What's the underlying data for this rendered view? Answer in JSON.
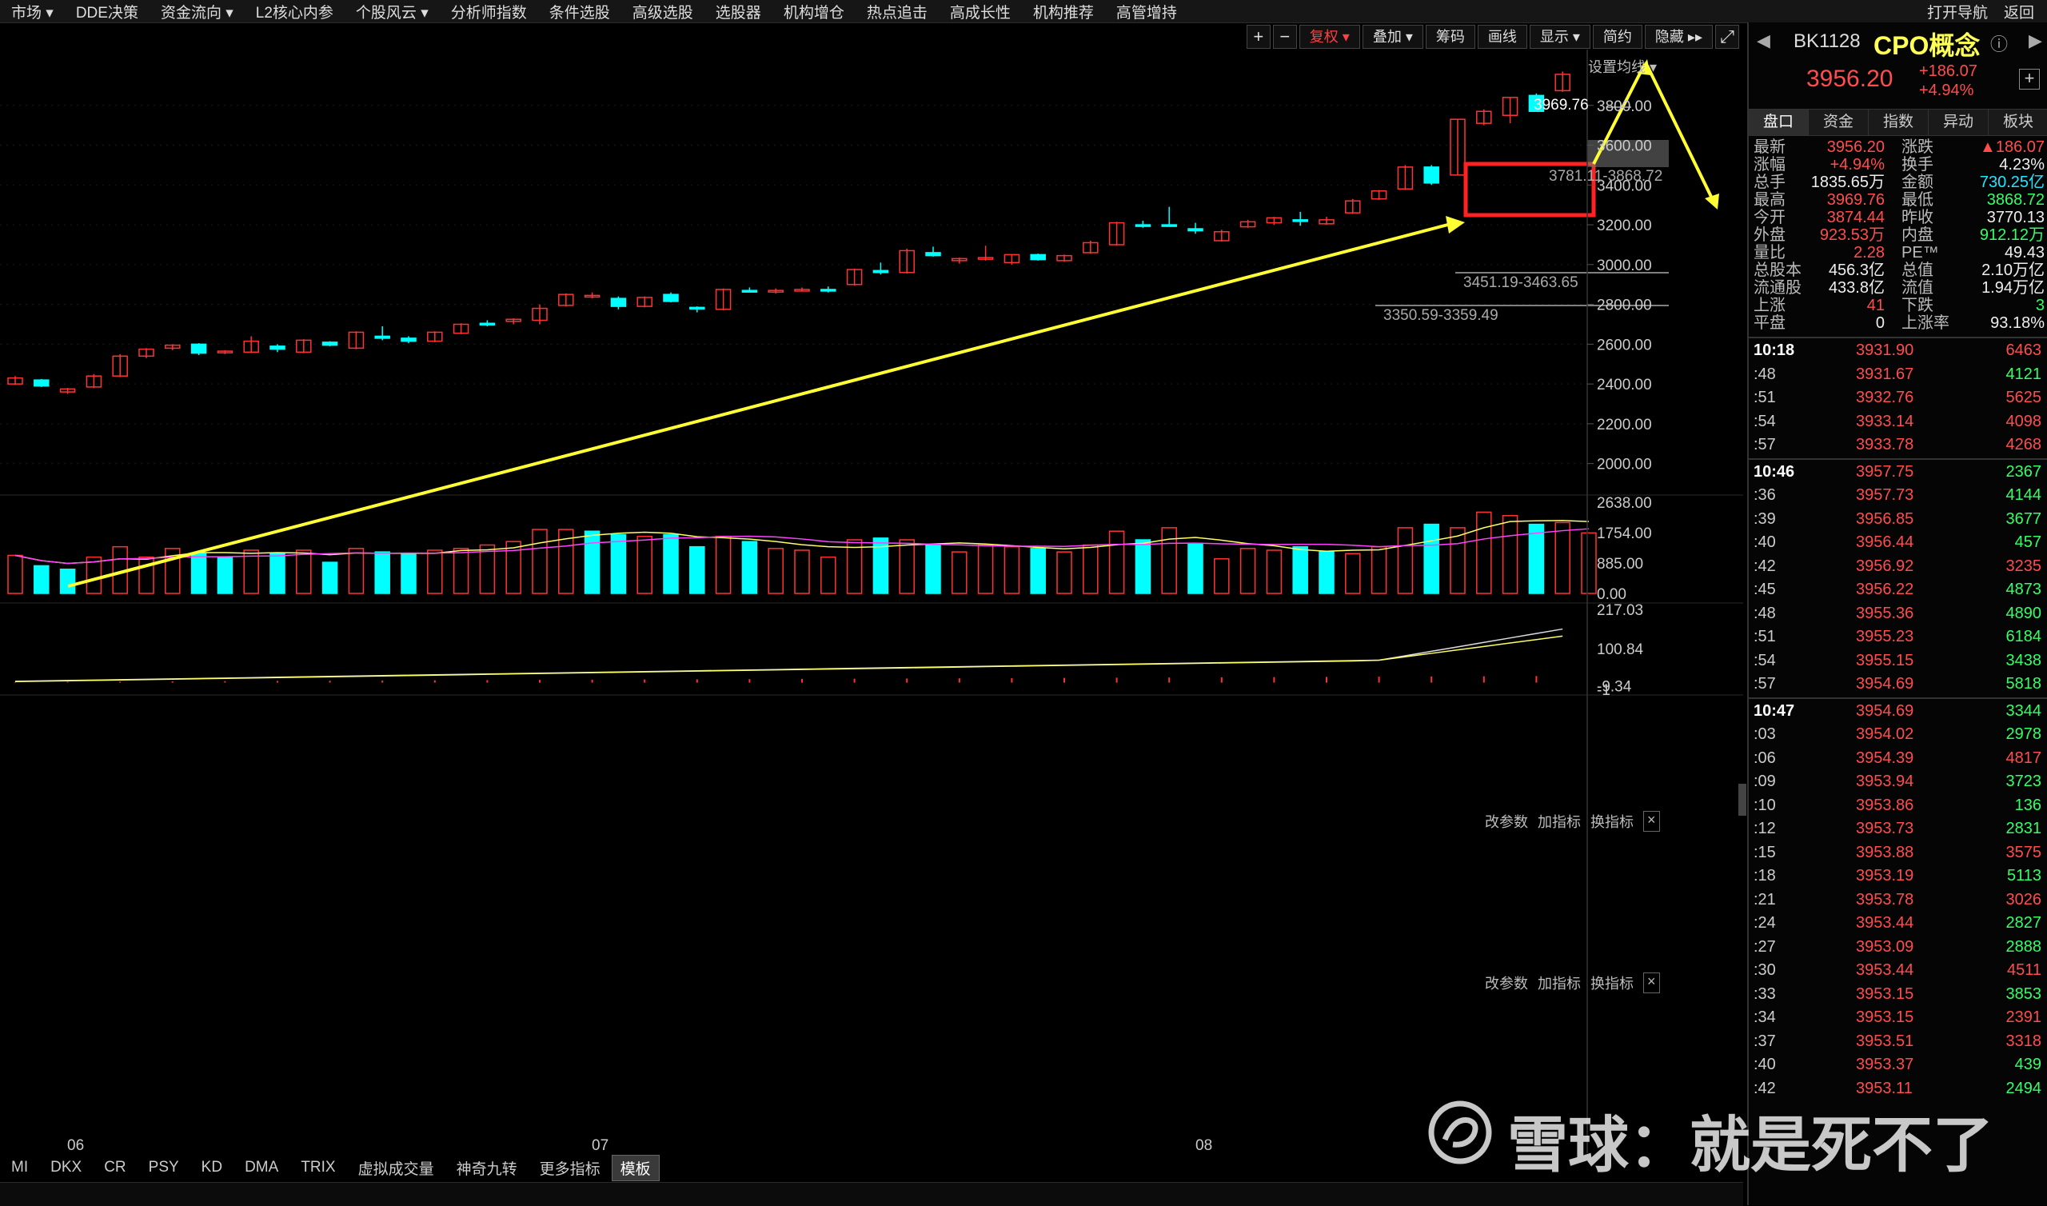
{
  "topmenu": {
    "items": [
      "市场 ▾",
      "DDE决策",
      "资金流向 ▾",
      "L2核心内参",
      "个股风云 ▾",
      "分析师指数",
      "条件选股",
      "高级选股",
      "选股器",
      "机构增仓",
      "热点追击",
      "高成长性",
      "机构推荐",
      "高管增持"
    ],
    "right": [
      "打开导航",
      "返回"
    ]
  },
  "toolbar": {
    "plus": "+",
    "minus": "−",
    "fuquan": "复权 ▾",
    "diejia": "叠加 ▾",
    "chouma": "筹码",
    "huaxian": "画线",
    "xianshi": "显示 ▾",
    "jianyue": "简约",
    "yincang": "隐藏 ▸▸",
    "fullscreen": "⤢"
  },
  "chart": {
    "set_ma_label": "设置均线 ▾",
    "high_label": "3969.76",
    "box_label_1": "3781.11-3868.72",
    "box_label_2": "3451.19-3463.65",
    "box_label_3": "3350.59-3359.49",
    "price_ticks": [
      "3800.00",
      "3600.00",
      "3400.00",
      "3200.00",
      "3000.00",
      "2800.00",
      "2600.00",
      "2400.00",
      "2200.00",
      "2000.00"
    ],
    "vol_ticks": [
      "2638.00",
      "1754.00",
      "885.00",
      "0.00"
    ],
    "macd_ticks": [
      "217.03",
      "100.84",
      "-9.34",
      "-1"
    ],
    "x_labels": [
      "06",
      "07",
      "08"
    ],
    "sub_links": [
      "改参数",
      "加指标",
      "换指标"
    ],
    "close_x": "×",
    "colors": {
      "up": "#ff3333",
      "down": "#00ffff",
      "arrow": "#ffff33",
      "box": "#ff2222",
      "ma1": "#ffff66",
      "ma2": "#ff44ff"
    }
  },
  "bottomtabs": [
    "MI",
    "DKX",
    "CR",
    "PSY",
    "KD",
    "DMA",
    "TRIX",
    "虚拟成交量",
    "神奇九转",
    "更多指标",
    "模板"
  ],
  "panel": {
    "code": "BK1128",
    "name": "CPO概念",
    "info_icon": "ⓘ",
    "price": "3956.20",
    "change": "+186.07",
    "change_pct": "+4.94%",
    "add": "+",
    "tabs": [
      "盘口",
      "资金",
      "指数",
      "异动",
      "板块"
    ],
    "quote": [
      [
        "最新",
        "3956.20",
        "涨跌",
        "▲186.07"
      ],
      [
        "涨幅",
        "+4.94%",
        "换手",
        "4.23%"
      ],
      [
        "总手",
        "1835.65万",
        "金额",
        "730.25亿"
      ],
      [
        "最高",
        "3969.76",
        "最低",
        "3868.72"
      ],
      [
        "今开",
        "3874.44",
        "昨收",
        "3770.13"
      ],
      [
        "外盘",
        "923.53万",
        "内盘",
        "912.12万"
      ],
      [
        "量比",
        "2.28",
        "PE™",
        "49.43"
      ],
      [
        "总股本",
        "456.3亿",
        "总值",
        "2.10万亿"
      ],
      [
        "流通股",
        "433.8亿",
        "流值",
        "1.94万亿"
      ],
      [
        "上涨",
        "41",
        "下跌",
        "3"
      ],
      [
        "平盘",
        "0",
        "上涨率",
        "93.18%"
      ]
    ],
    "ticks": [
      [
        "10:18",
        "3931.90",
        "6463",
        "r"
      ],
      [
        ":48",
        "3931.67",
        "4121",
        "g"
      ],
      [
        ":51",
        "3932.76",
        "5625",
        "r"
      ],
      [
        ":54",
        "3933.14",
        "4098",
        "r"
      ],
      [
        ":57",
        "3933.78",
        "4268",
        "r"
      ],
      [
        "10:46",
        "3957.75",
        "2367",
        "g"
      ],
      [
        ":36",
        "3957.73",
        "4144",
        "g"
      ],
      [
        ":39",
        "3956.85",
        "3677",
        "g"
      ],
      [
        ":40",
        "3956.44",
        "457",
        "g"
      ],
      [
        ":42",
        "3956.92",
        "3235",
        "r"
      ],
      [
        ":45",
        "3956.22",
        "4873",
        "g"
      ],
      [
        ":48",
        "3955.36",
        "4890",
        "g"
      ],
      [
        ":51",
        "3955.23",
        "6184",
        "g"
      ],
      [
        ":54",
        "3955.15",
        "3438",
        "g"
      ],
      [
        ":57",
        "3954.69",
        "5818",
        "g"
      ],
      [
        "10:47",
        "3954.69",
        "3344",
        "g"
      ],
      [
        ":03",
        "3954.02",
        "2978",
        "g"
      ],
      [
        ":06",
        "3954.39",
        "4817",
        "r"
      ],
      [
        ":09",
        "3953.94",
        "3723",
        "g"
      ],
      [
        ":10",
        "3953.86",
        "136",
        "g"
      ],
      [
        ":12",
        "3953.73",
        "2831",
        "g"
      ],
      [
        ":15",
        "3953.88",
        "3575",
        "r"
      ],
      [
        ":18",
        "3953.19",
        "5113",
        "g"
      ],
      [
        ":21",
        "3953.78",
        "3026",
        "r"
      ],
      [
        ":24",
        "3953.44",
        "2827",
        "g"
      ],
      [
        ":27",
        "3953.09",
        "2888",
        "g"
      ],
      [
        ":30",
        "3953.44",
        "4511",
        "r"
      ],
      [
        ":33",
        "3953.15",
        "3853",
        "g"
      ],
      [
        ":34",
        "3953.15",
        "2391",
        "r"
      ],
      [
        ":37",
        "3953.51",
        "3318",
        "r"
      ],
      [
        ":40",
        "3953.37",
        "439",
        "g"
      ],
      [
        ":42",
        "3953.11",
        "2494",
        "g"
      ]
    ]
  },
  "watermark": "雪球：就是死不了",
  "chart_data": {
    "type": "candlestick",
    "ylim": [
      1850,
      4000
    ],
    "ohlc": [
      [
        2430,
        2440,
        2395,
        2400,
        "u"
      ],
      [
        2420,
        2425,
        2385,
        2390,
        "d"
      ],
      [
        2360,
        2380,
        2350,
        2375,
        "u"
      ],
      [
        2385,
        2450,
        2380,
        2440,
        "u"
      ],
      [
        2440,
        2550,
        2435,
        2540,
        "u"
      ],
      [
        2540,
        2580,
        2530,
        2575,
        "u"
      ],
      [
        2580,
        2600,
        2570,
        2595,
        "u"
      ],
      [
        2600,
        2605,
        2545,
        2555,
        "d"
      ],
      [
        2560,
        2570,
        2550,
        2565,
        "u"
      ],
      [
        2560,
        2640,
        2555,
        2615,
        "u"
      ],
      [
        2590,
        2600,
        2560,
        2575,
        "d"
      ],
      [
        2560,
        2625,
        2555,
        2620,
        "u"
      ],
      [
        2610,
        2615,
        2590,
        2595,
        "d"
      ],
      [
        2580,
        2665,
        2575,
        2660,
        "u"
      ],
      [
        2640,
        2690,
        2620,
        2630,
        "d"
      ],
      [
        2630,
        2640,
        2605,
        2615,
        "d"
      ],
      [
        2615,
        2665,
        2610,
        2660,
        "u"
      ],
      [
        2655,
        2705,
        2650,
        2700,
        "u"
      ],
      [
        2700,
        2720,
        2690,
        2705,
        "d"
      ],
      [
        2715,
        2730,
        2700,
        2725,
        "u"
      ],
      [
        2720,
        2800,
        2700,
        2780,
        "u"
      ],
      [
        2795,
        2855,
        2790,
        2850,
        "u"
      ],
      [
        2845,
        2860,
        2830,
        2840,
        "u"
      ],
      [
        2830,
        2840,
        2775,
        2790,
        "d"
      ],
      [
        2790,
        2840,
        2785,
        2835,
        "u"
      ],
      [
        2850,
        2860,
        2810,
        2815,
        "d"
      ],
      [
        2780,
        2790,
        2760,
        2785,
        "d"
      ],
      [
        2775,
        2880,
        2770,
        2875,
        "u"
      ],
      [
        2870,
        2885,
        2860,
        2870,
        "d"
      ],
      [
        2865,
        2880,
        2855,
        2870,
        "u"
      ],
      [
        2870,
        2885,
        2865,
        2875,
        "u"
      ],
      [
        2875,
        2890,
        2860,
        2870,
        "d"
      ],
      [
        2900,
        2980,
        2895,
        2975,
        "u"
      ],
      [
        2970,
        3010,
        2950,
        2960,
        "d"
      ],
      [
        2960,
        3080,
        2955,
        3070,
        "u"
      ],
      [
        3060,
        3090,
        3040,
        3045,
        "d"
      ],
      [
        3020,
        3035,
        3005,
        3030,
        "u"
      ],
      [
        3030,
        3095,
        3020,
        3035,
        "u"
      ],
      [
        3010,
        3050,
        3000,
        3050,
        "u"
      ],
      [
        3050,
        3055,
        3020,
        3025,
        "d"
      ],
      [
        3020,
        3050,
        3015,
        3045,
        "u"
      ],
      [
        3060,
        3120,
        3055,
        3110,
        "u"
      ],
      [
        3100,
        3215,
        3095,
        3210,
        "u"
      ],
      [
        3200,
        3220,
        3185,
        3195,
        "d"
      ],
      [
        3200,
        3290,
        3190,
        3195,
        "d"
      ],
      [
        3180,
        3210,
        3155,
        3170,
        "d"
      ],
      [
        3120,
        3175,
        3115,
        3165,
        "u"
      ],
      [
        3190,
        3225,
        3185,
        3215,
        "u"
      ],
      [
        3210,
        3240,
        3200,
        3235,
        "u"
      ],
      [
        3225,
        3265,
        3195,
        3220,
        "d"
      ],
      [
        3205,
        3240,
        3200,
        3225,
        "u"
      ],
      [
        3260,
        3330,
        3255,
        3320,
        "u"
      ],
      [
        3330,
        3375,
        3325,
        3370,
        "u"
      ],
      [
        3380,
        3500,
        3375,
        3490,
        "u"
      ],
      [
        3490,
        3500,
        3400,
        3410,
        "d"
      ],
      [
        3450,
        3730,
        3450,
        3730,
        "u"
      ],
      [
        3710,
        3780,
        3700,
        3770,
        "u"
      ],
      [
        3750,
        3840,
        3710,
        3840,
        "u"
      ],
      [
        3850,
        3860,
        3780,
        3770,
        "d"
      ],
      [
        3874,
        3970,
        3868,
        3956,
        "u"
      ]
    ],
    "volume": [
      [
        1100,
        "u"
      ],
      [
        800,
        "d"
      ],
      [
        700,
        "d"
      ],
      [
        1050,
        "u"
      ],
      [
        1350,
        "u"
      ],
      [
        1050,
        "u"
      ],
      [
        1300,
        "u"
      ],
      [
        1150,
        "d"
      ],
      [
        1050,
        "d"
      ],
      [
        1250,
        "u"
      ],
      [
        1150,
        "d"
      ],
      [
        1250,
        "u"
      ],
      [
        900,
        "d"
      ],
      [
        1300,
        "u"
      ],
      [
        1200,
        "d"
      ],
      [
        1150,
        "d"
      ],
      [
        1250,
        "u"
      ],
      [
        1300,
        "u"
      ],
      [
        1400,
        "u"
      ],
      [
        1500,
        "u"
      ],
      [
        1850,
        "u"
      ],
      [
        1850,
        "u"
      ],
      [
        1800,
        "d"
      ],
      [
        1700,
        "d"
      ],
      [
        1650,
        "u"
      ],
      [
        1700,
        "d"
      ],
      [
        1350,
        "d"
      ],
      [
        1650,
        "u"
      ],
      [
        1500,
        "d"
      ],
      [
        1300,
        "u"
      ],
      [
        1250,
        "u"
      ],
      [
        1050,
        "u"
      ],
      [
        1550,
        "u"
      ],
      [
        1600,
        "d"
      ],
      [
        1550,
        "u"
      ],
      [
        1400,
        "d"
      ],
      [
        1200,
        "u"
      ],
      [
        1400,
        "u"
      ],
      [
        1350,
        "u"
      ],
      [
        1300,
        "d"
      ],
      [
        1200,
        "u"
      ],
      [
        1400,
        "u"
      ],
      [
        1800,
        "u"
      ],
      [
        1550,
        "d"
      ],
      [
        1900,
        "u"
      ],
      [
        1450,
        "d"
      ],
      [
        1000,
        "u"
      ],
      [
        1300,
        "u"
      ],
      [
        1250,
        "u"
      ],
      [
        1350,
        "d"
      ],
      [
        1200,
        "d"
      ],
      [
        1150,
        "u"
      ],
      [
        1350,
        "u"
      ],
      [
        1900,
        "u"
      ],
      [
        2000,
        "d"
      ],
      [
        1900,
        "u"
      ],
      [
        2350,
        "u"
      ],
      [
        2250,
        "u"
      ],
      [
        2000,
        "d"
      ],
      [
        2050,
        "u"
      ],
      [
        1750,
        "u"
      ]
    ],
    "vol_ylim": [
      0,
      2638
    ],
    "macd_ylim": [
      -20,
      217
    ]
  }
}
